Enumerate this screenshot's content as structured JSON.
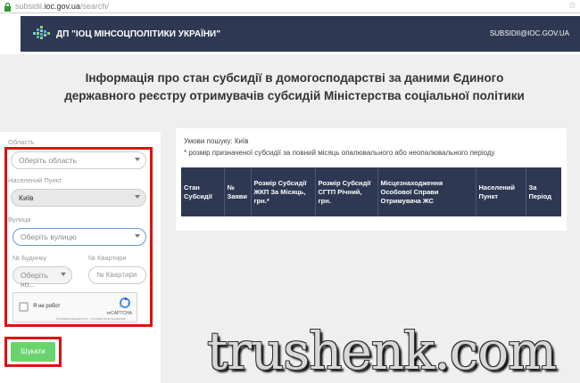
{
  "browser": {
    "url_prefix": "subsidii.",
    "url_host": "ioc.gov.ua",
    "url_path": "/search/"
  },
  "header": {
    "brand": "ДП \"ІОЦ МІНСОЦПОЛІТИКИ УКРАЇНИ\"",
    "email": "SUBSIDII@IOC.GOV.UA"
  },
  "page_title": "Інформація про стан субсидії в домогосподарстві за даними Єдиного державного реєстру отримувачів субсидій Міністерства соціальної політики",
  "form": {
    "oblast_label": "Область",
    "oblast_placeholder": "Оберіть область",
    "settlement_label": "Населений Пункт",
    "settlement_value": "Київ",
    "street_label": "Вулиця",
    "street_placeholder": "Оберіть вулицю",
    "building_label": "№ Будинку",
    "building_placeholder": "Оберіть но...",
    "apartment_label": "№ Квартири",
    "apartment_placeholder": "№ Квартири",
    "captcha_label": "Я не робот",
    "captcha_brand": "reCAPTCHA",
    "captcha_links": "Конфиденциальность - Условия использования",
    "search_button": "Шукати"
  },
  "results": {
    "conditions": "Умови пошуку: Київ",
    "note": "* розмір призначеної субсидії за повний місяць опалювального або неопалювального періоду",
    "columns": [
      "Стан Субсидії",
      "№ Заяви",
      "Розмір Субсидії ЖКП За Місяць, грн.*",
      "Розмір Субсидії СГТП Річний, грн.",
      "Місцезнаходження Особової Справи Отримувача ЖС",
      "Населений Пункт",
      "За Період"
    ]
  },
  "watermark": "trushenk.com",
  "colors": {
    "header_bg": "#2e3852",
    "search_button": "#69d36e",
    "highlight": "#e01010"
  }
}
